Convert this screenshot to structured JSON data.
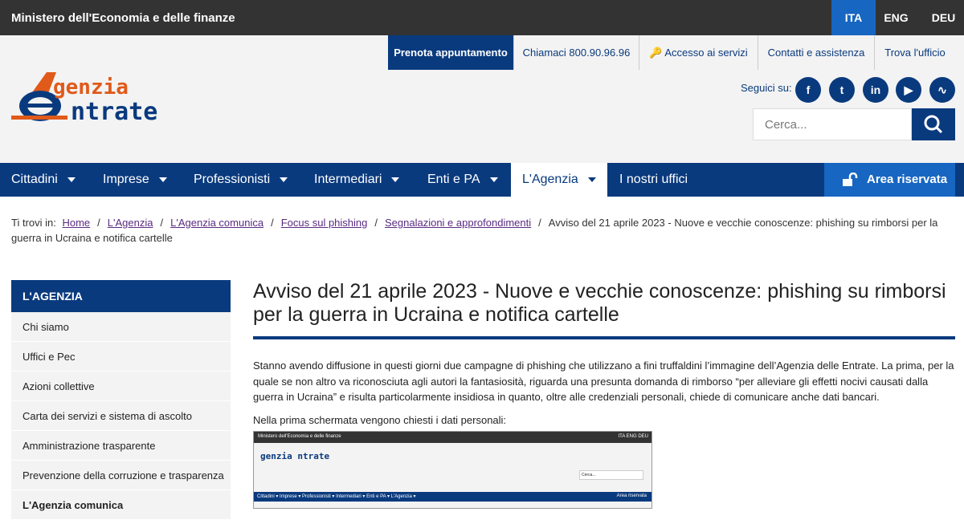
{
  "topbar": {
    "ministry": "Ministero dell'Economia e delle finanze",
    "languages": [
      "ITA",
      "ENG",
      "DEU"
    ],
    "active_lang": "ITA"
  },
  "services": [
    "Prenota appuntamento",
    "Chiamaci 800.90.96.96",
    "Accesso ai servizi",
    "Contatti e assistenza",
    "Trova l'ufficio"
  ],
  "logo": {
    "line1": "genzia",
    "line2": "ntrate"
  },
  "social": {
    "label": "Seguici su:",
    "icons": [
      "facebook-icon",
      "twitter-icon",
      "linkedin-icon",
      "youtube-icon",
      "rss-icon"
    ]
  },
  "search": {
    "placeholder": "Cerca..."
  },
  "nav": {
    "items": [
      "Cittadini",
      "Imprese",
      "Professionisti",
      "Intermediari",
      "Enti e PA",
      "L'Agenzia",
      "I nostri uffici"
    ],
    "active": "L'Agenzia",
    "reserved": "Area riservata"
  },
  "breadcrumb": {
    "prefix": "Ti trovi in:",
    "links": [
      "Home",
      "L'Agenzia",
      "L'Agenzia comunica",
      "Focus sul phishing",
      "Segnalazioni e approfondimenti"
    ],
    "current": "Avviso del 21 aprile 2023 - Nuove e vecchie conoscenze: phishing su rimborsi per la guerra in Ucraina e notifica cartelle"
  },
  "sidebar": {
    "title": "L'AGENZIA",
    "items": [
      "Chi siamo",
      "Uffici e Pec",
      "Azioni collettive",
      "Carta dei servizi e sistema di ascolto",
      "Amministrazione trasparente",
      "Prevenzione della corruzione e trasparenza",
      "L'Agenzia comunica"
    ]
  },
  "main": {
    "title": "Avviso del 21 aprile 2023 - Nuove e vecchie conoscenze: phishing su rimborsi per la guerra in Ucraina e notifica cartelle",
    "paragraph": "Stanno avendo diffusione in questi giorni due campagne di phishing che utilizzano a fini truffaldini l’immagine dell’Agenzia delle Entrate. La prima, per la quale se non altro va riconosciuta agli autori la fantasiosità, riguarda una presunta domanda di rimborso “per alleviare gli effetti nocivi causati dalla guerra in Ucraina” e risulta particolarmente insidiosa in quanto, oltre alle credenziali personali, chiede di comunicare anche dati bancari.",
    "paragraph2": "Nella prima schermata vengono chiesti i dati personali:",
    "screenshot": {
      "bar": "Ministero dell'Economia e delle finanze",
      "langs": "ITA  ENG  DEU",
      "logo": "genzia ntrate",
      "search": "Cerca...",
      "nav": "Cittadini ▾   Imprese ▾   Professionisti ▾   Intermediari ▾   Enti e PA ▾   L'Agenzia ▾",
      "reserved": "Area riservata"
    }
  },
  "colors": {
    "brand_blue": "#0a3a7e",
    "accent_blue": "#1766c2",
    "orange": "#e05a1a",
    "topbar": "#333333"
  }
}
